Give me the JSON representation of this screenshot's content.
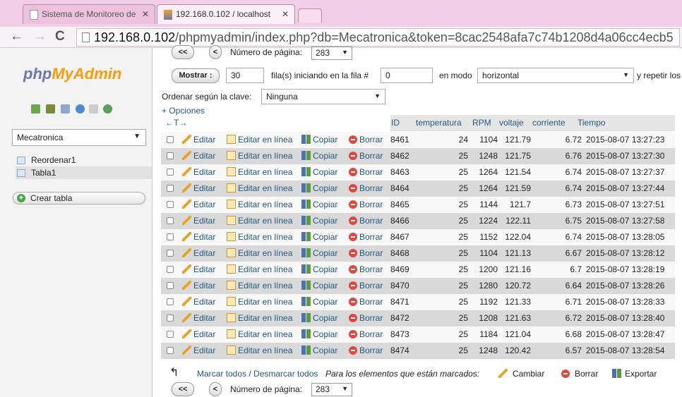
{
  "browser": {
    "tabs": [
      {
        "label": "Sistema de Monitoreo de",
        "active": false
      },
      {
        "label": "192.168.0.102 / localhost",
        "active": true
      }
    ],
    "url_host": "192.168.0.102",
    "url_path": "/phpmyadmin/index.php?db=Mecatronica&token=8cac2548afa7c74b1208d4a06cc4ecb5"
  },
  "sidebar": {
    "logo_a": "php",
    "logo_b": "MyAdmin",
    "database": "Mecatronica",
    "tables": [
      "Reordenar1",
      "Tabla1"
    ],
    "create_table": "Crear tabla"
  },
  "nav": {
    "prev_label": "<<",
    "prev_single": "<",
    "page_label": "Número de página:",
    "page_value": "283",
    "show_button": "Mostrar :",
    "rows_value": "30",
    "rows_label": "fila(s) iniciando en la fila #",
    "start_value": "0",
    "mode_label": "en modo",
    "mode_value": "horizontal",
    "repeat_label": "y repetir los",
    "sort_label": "Ordenar según la clave:",
    "sort_value": "Ninguna",
    "options": "+ Opciones"
  },
  "table": {
    "move_symbol": "←T→",
    "headers": [
      "ID",
      "temperatura",
      "RPM",
      "voltaje",
      "corriente",
      "Tiempo"
    ],
    "actions": {
      "edit": "Editar",
      "inline": "Editar en línea",
      "copy": "Copiar",
      "delete": "Borrar"
    },
    "rows": [
      {
        "id": "8461",
        "temp": "24",
        "rpm": "1104",
        "volt": "121.79",
        "curr": "6.72",
        "time": "2015-08-07 13:27:23"
      },
      {
        "id": "8462",
        "temp": "25",
        "rpm": "1248",
        "volt": "121.75",
        "curr": "6.76",
        "time": "2015-08-07 13:27:30"
      },
      {
        "id": "8463",
        "temp": "25",
        "rpm": "1264",
        "volt": "121.54",
        "curr": "6.74",
        "time": "2015-08-07 13:27:37"
      },
      {
        "id": "8464",
        "temp": "25",
        "rpm": "1264",
        "volt": "121.59",
        "curr": "6.74",
        "time": "2015-08-07 13:27:44"
      },
      {
        "id": "8465",
        "temp": "25",
        "rpm": "1144",
        "volt": "121.7",
        "curr": "6.73",
        "time": "2015-08-07 13:27:51"
      },
      {
        "id": "8466",
        "temp": "25",
        "rpm": "1224",
        "volt": "122.11",
        "curr": "6.75",
        "time": "2015-08-07 13:27:58"
      },
      {
        "id": "8467",
        "temp": "25",
        "rpm": "1152",
        "volt": "122.04",
        "curr": "6.74",
        "time": "2015-08-07 13:28:05"
      },
      {
        "id": "8468",
        "temp": "25",
        "rpm": "1104",
        "volt": "121.13",
        "curr": "6.67",
        "time": "2015-08-07 13:28:12"
      },
      {
        "id": "8469",
        "temp": "25",
        "rpm": "1200",
        "volt": "121.16",
        "curr": "6.7",
        "time": "2015-08-07 13:28:19"
      },
      {
        "id": "8470",
        "temp": "25",
        "rpm": "1280",
        "volt": "120.72",
        "curr": "6.64",
        "time": "2015-08-07 13:28:26"
      },
      {
        "id": "8471",
        "temp": "25",
        "rpm": "1192",
        "volt": "121.33",
        "curr": "6.71",
        "time": "2015-08-07 13:28:33"
      },
      {
        "id": "8472",
        "temp": "25",
        "rpm": "1208",
        "volt": "121.63",
        "curr": "6.72",
        "time": "2015-08-07 13:28:40"
      },
      {
        "id": "8473",
        "temp": "25",
        "rpm": "1184",
        "volt": "121.04",
        "curr": "6.68",
        "time": "2015-08-07 13:28:47"
      },
      {
        "id": "8474",
        "temp": "25",
        "rpm": "1248",
        "volt": "120.42",
        "curr": "6.57",
        "time": "2015-08-07 13:28:54"
      }
    ]
  },
  "footer": {
    "mark_all": "Marcar todos / Desmarcar todos",
    "for_selected": "Para los elementos que están marcados:",
    "change": "Cambiar",
    "delete": "Borrar",
    "export": "Exportar"
  }
}
